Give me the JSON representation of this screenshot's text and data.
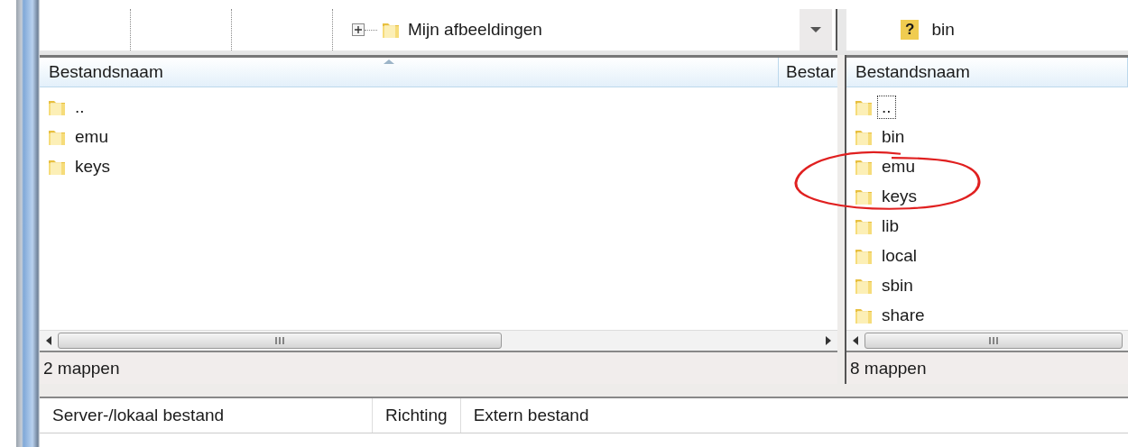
{
  "local_tree": {
    "items": [
      {
        "label": "Mijn afbeeldingen",
        "expanded": false
      }
    ]
  },
  "remote_tree": {
    "items": [
      {
        "icon": "?",
        "label": "bin"
      }
    ]
  },
  "local_panel": {
    "columns": [
      "Bestandsnaam",
      "Bestar"
    ],
    "rows": [
      {
        "name": "..",
        "selected": false
      },
      {
        "name": "emu",
        "selected": false
      },
      {
        "name": "keys",
        "selected": false
      }
    ],
    "status": "2 mappen"
  },
  "remote_panel": {
    "columns": [
      "Bestandsnaam"
    ],
    "rows": [
      {
        "name": "..",
        "selected": true
      },
      {
        "name": "bin",
        "selected": false
      },
      {
        "name": "emu",
        "selected": false
      },
      {
        "name": "keys",
        "selected": false
      },
      {
        "name": "lib",
        "selected": false
      },
      {
        "name": "local",
        "selected": false
      },
      {
        "name": "sbin",
        "selected": false
      },
      {
        "name": "share",
        "selected": false
      }
    ],
    "status": "8 mappen"
  },
  "queue": {
    "columns": [
      "Server-/lokaal bestand",
      "Richting",
      "Extern bestand"
    ]
  }
}
